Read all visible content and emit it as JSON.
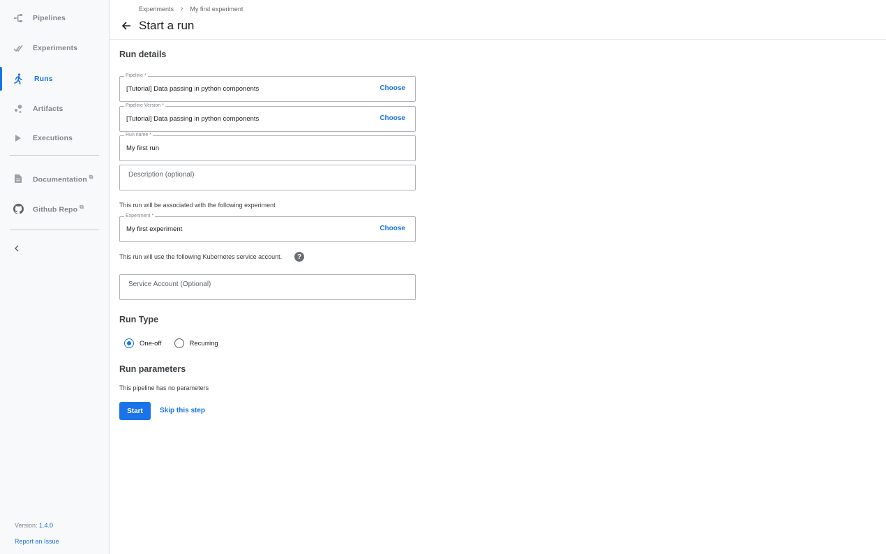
{
  "sidebar": {
    "items": [
      {
        "label": "Pipelines",
        "icon": "pipelines-icon"
      },
      {
        "label": "Experiments",
        "icon": "experiments-icon"
      },
      {
        "label": "Runs",
        "icon": "runs-icon",
        "active": true
      },
      {
        "label": "Artifacts",
        "icon": "artifacts-icon"
      },
      {
        "label": "Executions",
        "icon": "executions-icon"
      }
    ],
    "links": [
      {
        "label": "Documentation",
        "icon": "document-icon"
      },
      {
        "label": "Github Repo",
        "icon": "github-icon"
      }
    ],
    "version_label": "Version: ",
    "version_value": "1.4.0",
    "report_issue": "Report an Issue"
  },
  "header": {
    "breadcrumb": [
      "Experiments",
      "My first experiment"
    ],
    "breadcrumb_sep": "›",
    "title": "Start a run"
  },
  "form": {
    "run_details_title": "Run details",
    "pipeline": {
      "legend": "Pipeline *",
      "value": "[Tutorial] Data passing in python components",
      "action": "Choose"
    },
    "pipeline_version": {
      "legend": "Pipeline Version *",
      "value": "[Tutorial] Data passing in python components",
      "action": "Choose"
    },
    "run_name": {
      "legend": "Run name *",
      "value": "My first run"
    },
    "description": {
      "placeholder": "Description (optional)"
    },
    "experiment_note": "This run will be associated with the following experiment",
    "experiment": {
      "legend": "Experiment *",
      "value": "My first experiment",
      "action": "Choose"
    },
    "service_account_note": "This run will use the following Kubernetes service account.",
    "help_glyph": "?",
    "service_account": {
      "placeholder": "Service Account (Optional)"
    },
    "run_type_title": "Run Type",
    "run_types": [
      {
        "label": "One-off",
        "checked": true
      },
      {
        "label": "Recurring",
        "checked": false
      }
    ],
    "run_parameters_title": "Run parameters",
    "no_parameters": "This pipeline has no parameters",
    "start_label": "Start",
    "skip_label": "Skip this step"
  },
  "colors": {
    "accent": "#1a73e8",
    "sidebar_bg": "#f8f9fa"
  }
}
